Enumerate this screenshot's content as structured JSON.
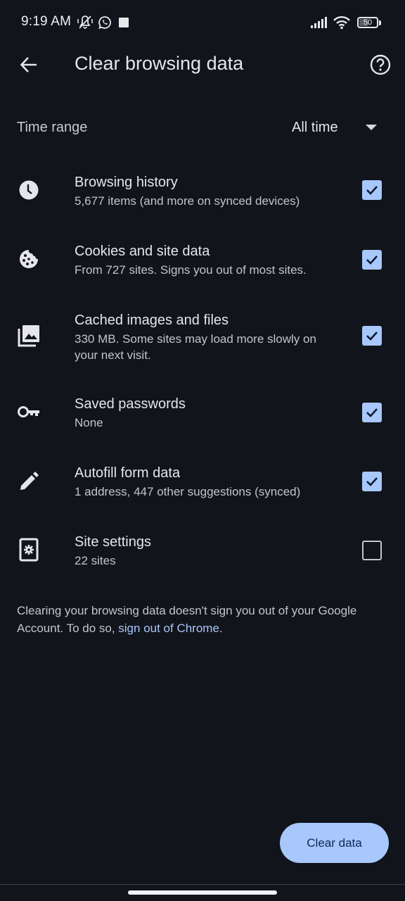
{
  "status_bar": {
    "time": "9:19 AM",
    "left_icons": [
      "vibrate-off-icon",
      "whatsapp-icon",
      "square-notification-icon"
    ],
    "right_icons": [
      "cellular-signal-icon",
      "wifi-icon",
      "battery-icon"
    ],
    "battery_level": "50",
    "battery_percent": 50
  },
  "app_bar": {
    "title": "Clear browsing data",
    "back_icon": "arrow-back-icon",
    "help_icon": "help-circle-icon"
  },
  "time_range": {
    "label": "Time range",
    "value": "All time",
    "icon": "dropdown-arrow-icon"
  },
  "items": [
    {
      "icon": "clock-icon",
      "title": "Browsing history",
      "subtitle": "5,677 items (and more on synced devices)",
      "checked": true
    },
    {
      "icon": "cookie-icon",
      "title": "Cookies and site data",
      "subtitle": "From 727 sites. Signs you out of most sites.",
      "checked": true
    },
    {
      "icon": "images-icon",
      "title": "Cached images and files",
      "subtitle": "330 MB. Some sites may load more slowly on your next visit.",
      "checked": true
    },
    {
      "icon": "key-icon",
      "title": "Saved passwords",
      "subtitle": "None",
      "checked": true
    },
    {
      "icon": "pencil-icon",
      "title": "Autofill form data",
      "subtitle": "1 address, 447 other suggestions (synced)",
      "checked": true
    },
    {
      "icon": "site-settings-icon",
      "title": "Site settings",
      "subtitle": "22 sites",
      "checked": false
    }
  ],
  "footer": {
    "note_prefix": "Clearing your browsing data doesn't sign you out of your Google Account. To do so, ",
    "link_text": "sign out of Chrome",
    "note_suffix": "."
  },
  "actions": {
    "clear_label": "Clear data"
  },
  "colors": {
    "background": "#11141b",
    "accent": "#a8c7fa",
    "button_text": "#0b2a5a",
    "primary_text": "#e6e6ea",
    "secondary_text": "#c4c4ca"
  }
}
